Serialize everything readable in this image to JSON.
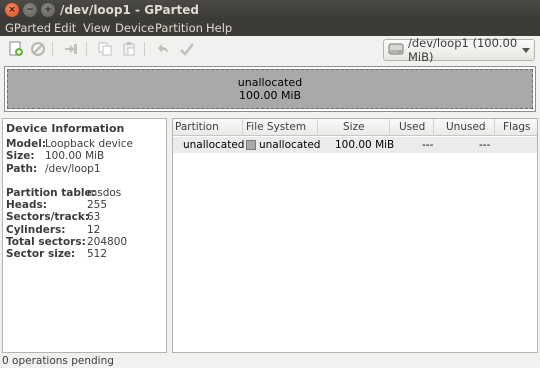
{
  "window": {
    "title": "/dev/loop1 - GParted"
  },
  "menubar": {
    "items": [
      "GParted",
      "Edit",
      "View",
      "Device",
      "Partition",
      "Help"
    ]
  },
  "toolbar": {
    "device_select": "/dev/loop1  (100.00 MiB)",
    "icons": [
      "new-partition-icon",
      "delete-icon",
      "resize-move-icon",
      "copy-icon",
      "paste-icon",
      "undo-icon",
      "apply-icon",
      "harddisk-icon"
    ]
  },
  "disk_map": {
    "label": "unallocated",
    "size": "100.00 MiB"
  },
  "device_info": {
    "title": "Device Information",
    "model_label": "Model:",
    "model": "Loopback device",
    "size_label": "Size:",
    "size": "100.00 MiB",
    "path_label": "Path:",
    "path": "/dev/loop1",
    "partition_table_label": "Partition table:",
    "partition_table": "msdos",
    "heads_label": "Heads:",
    "heads": "255",
    "sectors_track_label": "Sectors/track:",
    "sectors_track": "63",
    "cylinders_label": "Cylinders:",
    "cylinders": "12",
    "total_sectors_label": "Total sectors:",
    "total_sectors": "204800",
    "sector_size_label": "Sector size:",
    "sector_size": "512"
  },
  "partitions": {
    "columns": [
      "Partition",
      "File System",
      "Size",
      "Used",
      "Unused",
      "Flags"
    ],
    "rows": [
      {
        "partition": "unallocated",
        "filesystem": "unallocated",
        "size": "100.00 MiB",
        "used": "---",
        "unused": "---",
        "flags": "",
        "fs_color": "#a9a9a9"
      }
    ]
  },
  "statusbar": {
    "text": "0 operations pending"
  }
}
